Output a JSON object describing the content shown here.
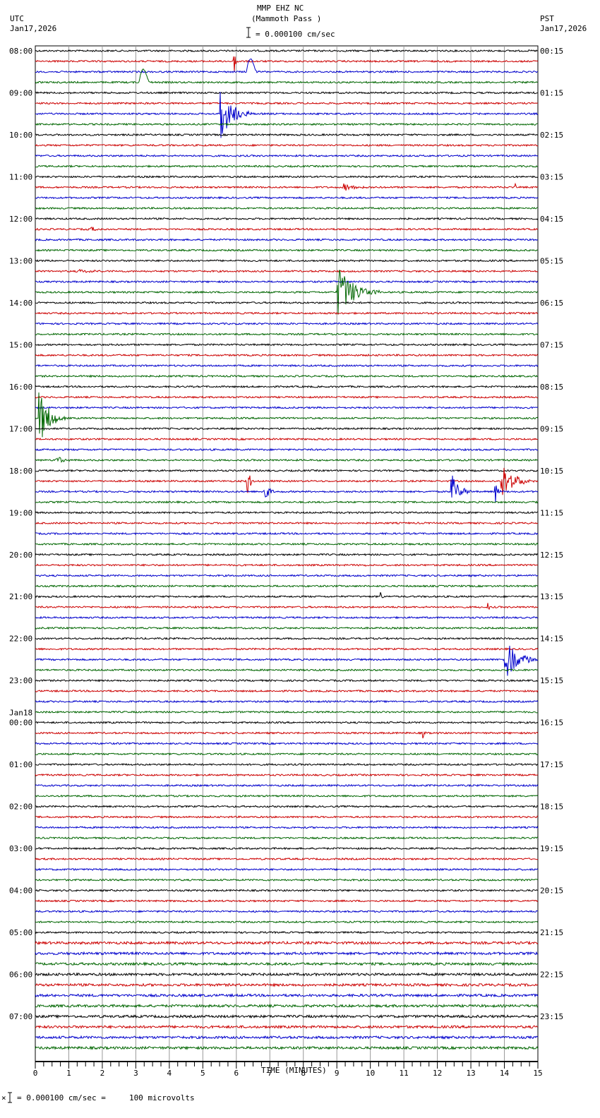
{
  "header": {
    "station": "MMP EHZ NC",
    "location": "(Mammoth Pass )",
    "scale": "= 0.000100 cm/sec",
    "left_tz": "UTC",
    "left_date": "Jan17,2026",
    "right_tz": "PST",
    "right_date": "Jan17,2026"
  },
  "footer": {
    "scale_note": "= 0.000100 cm/sec =     100 microvolts"
  },
  "chart_data": {
    "type": "line",
    "title": "MMP EHZ NC (Mammoth Pass )",
    "xlabel": "TIME (MINUTES)",
    "xlim": [
      0,
      15
    ],
    "x_ticks": [
      "0",
      "1",
      "2",
      "3",
      "4",
      "5",
      "6",
      "7",
      "8",
      "9",
      "10",
      "11",
      "12",
      "13",
      "14",
      "15"
    ],
    "trace_minutes": 15,
    "trace_count": 96,
    "trace_colors": [
      "#000000",
      "#cc0000",
      "#0000cc",
      "#006600"
    ],
    "left_labels": [
      "08:00",
      "09:00",
      "10:00",
      "11:00",
      "12:00",
      "13:00",
      "14:00",
      "15:00",
      "16:00",
      "17:00",
      "18:00",
      "19:00",
      "20:00",
      "21:00",
      "22:00",
      "23:00",
      "00:00",
      "01:00",
      "02:00",
      "03:00",
      "04:00",
      "05:00",
      "06:00",
      "07:00"
    ],
    "date_change_label": "Jan18",
    "date_change_hour_index": 16,
    "right_labels": [
      "00:15",
      "01:15",
      "02:15",
      "03:15",
      "04:15",
      "05:15",
      "06:15",
      "07:15",
      "08:15",
      "09:15",
      "10:15",
      "11:15",
      "12:15",
      "13:15",
      "14:15",
      "15:15",
      "16:15",
      "17:15",
      "18:15",
      "19:15",
      "20:15",
      "21:15",
      "22:15",
      "23:15"
    ],
    "events": [
      {
        "trace": 1,
        "minute": 5.9,
        "amp": 40,
        "dur": 0.15
      },
      {
        "trace": 2,
        "minute": 6.3,
        "amp": -28,
        "dur": 0.3,
        "kind": "dip"
      },
      {
        "trace": 3,
        "minute": 3.1,
        "amp": -30,
        "dur": 0.3,
        "kind": "dip"
      },
      {
        "trace": 6,
        "minute": 5.5,
        "amp": 40,
        "dur": 1.0
      },
      {
        "trace": 13,
        "minute": 9.2,
        "amp": 6,
        "dur": 1.0
      },
      {
        "trace": 13,
        "minute": 14.3,
        "amp": 8,
        "dur": 0.15
      },
      {
        "trace": 17,
        "minute": 1.6,
        "amp": 4,
        "dur": 0.8
      },
      {
        "trace": 21,
        "minute": 1.3,
        "amp": 4,
        "dur": 0.8
      },
      {
        "trace": 23,
        "minute": 9.0,
        "amp": 40,
        "dur": 1.3
      },
      {
        "trace": 35,
        "minute": 0.1,
        "amp": 45,
        "dur": 0.8
      },
      {
        "trace": 39,
        "minute": 0.6,
        "amp": 8,
        "dur": 0.5
      },
      {
        "trace": 41,
        "minute": 6.3,
        "amp": 25,
        "dur": 0.3
      },
      {
        "trace": 41,
        "minute": 13.9,
        "amp": 28,
        "dur": 1.0
      },
      {
        "trace": 42,
        "minute": 6.8,
        "amp": 30,
        "dur": 0.3
      },
      {
        "trace": 42,
        "minute": 12.4,
        "amp": 30,
        "dur": 0.6
      },
      {
        "trace": 42,
        "minute": 13.7,
        "amp": 30,
        "dur": 0.2
      },
      {
        "trace": 49,
        "minute": 9.8,
        "amp": 5,
        "dur": 0.2
      },
      {
        "trace": 52,
        "minute": 10.3,
        "amp": 10,
        "dur": 0.1
      },
      {
        "trace": 53,
        "minute": 13.5,
        "amp": 10,
        "dur": 0.1
      },
      {
        "trace": 58,
        "minute": 14.0,
        "amp": 35,
        "dur": 1.0
      },
      {
        "trace": 65,
        "minute": 11.55,
        "amp": 10,
        "dur": 0.15
      }
    ]
  }
}
